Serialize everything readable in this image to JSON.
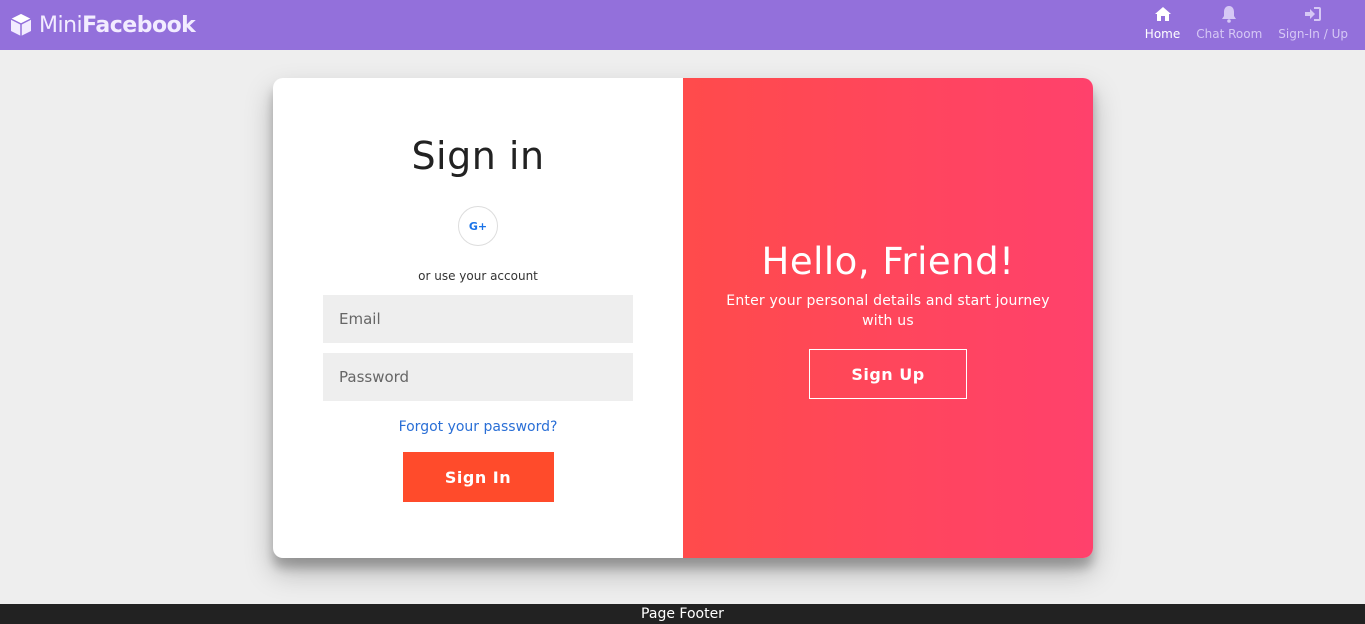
{
  "navbar": {
    "brand_light": "Mini",
    "brand_bold": "Facebook",
    "brand_icon": "cube-icon",
    "items": [
      {
        "label": "Home",
        "icon": "home-icon",
        "active": true
      },
      {
        "label": "Chat Room",
        "icon": "bell-icon",
        "active": false
      },
      {
        "label": "Sign-In / Up",
        "icon": "sign-in-icon",
        "active": false
      }
    ]
  },
  "signin": {
    "title": "Sign in",
    "social_label": "G+",
    "alt_text": "or use your account",
    "email_placeholder": "Email",
    "password_placeholder": "Password",
    "forgot_link": "Forgot your password?",
    "button_label": "Sign In"
  },
  "overlay": {
    "title": "Hello, Friend!",
    "subtitle": "Enter your personal details and start journey with us",
    "button_label": "Sign Up"
  },
  "footer": {
    "text": "Page Footer"
  },
  "colors": {
    "navbar": "#9370db",
    "accent": "#ff4b2b",
    "gradient_start": "#ff4b4b",
    "gradient_end": "#ff416c",
    "link": "#2a6fd6",
    "footer": "#222222"
  }
}
